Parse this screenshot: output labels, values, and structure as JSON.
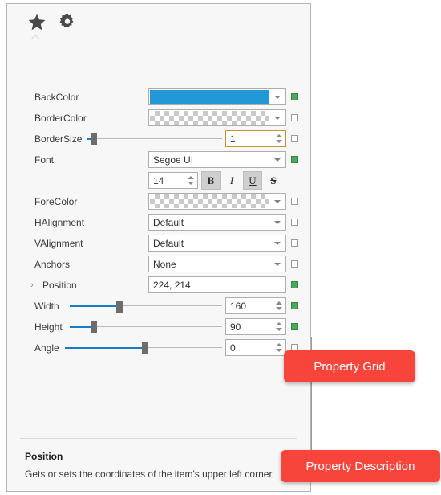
{
  "panel": {
    "tabs": [
      {
        "id": "favorites",
        "icon": "star-icon",
        "active": true
      },
      {
        "id": "settings",
        "icon": "gear-icon",
        "active": false
      }
    ]
  },
  "grid": {
    "rows": [
      {
        "label": "BackColor",
        "editor": "color",
        "value": "",
        "swatch": "#2299d6",
        "indicator": true
      },
      {
        "label": "BorderColor",
        "editor": "color",
        "value": "",
        "swatch": "transparent",
        "indicator": false
      },
      {
        "label": "BorderSize",
        "editor": "slider",
        "value": "1",
        "indicator": false,
        "slider_pct": 4,
        "focused": true
      },
      {
        "label": "Font",
        "editor": "combo",
        "value": "Segoe UI",
        "indicator": true
      },
      {
        "label": "",
        "editor": "fontstyle",
        "value": "14",
        "indicator": null
      },
      {
        "label": "ForeColor",
        "editor": "color",
        "value": "",
        "swatch": "transparent",
        "indicator": false
      },
      {
        "label": "HAlignment",
        "editor": "combo",
        "value": "Default",
        "indicator": false
      },
      {
        "label": "VAlignment",
        "editor": "combo",
        "value": "Default",
        "indicator": false
      },
      {
        "label": "Anchors",
        "editor": "combo",
        "value": "None",
        "indicator": false
      },
      {
        "label": "Position",
        "editor": "text",
        "value": "224, 214",
        "indicator": true,
        "expandable": true
      },
      {
        "label": "Width",
        "editor": "slider",
        "value": "160",
        "indicator": true,
        "slider_pct": 33
      },
      {
        "label": "Height",
        "editor": "slider",
        "value": "90",
        "indicator": true,
        "slider_pct": 17
      },
      {
        "label": "Angle",
        "editor": "slider",
        "value": "0",
        "indicator": false,
        "slider_pct": 52
      }
    ],
    "expander_glyph": "›"
  },
  "font_style": {
    "size": "14",
    "buttons": [
      {
        "name": "bold",
        "label": "B",
        "pressed": true
      },
      {
        "name": "italic",
        "label": "I",
        "pressed": false
      },
      {
        "name": "underline",
        "label": "U",
        "pressed": true
      },
      {
        "name": "strikeout",
        "label": "S",
        "pressed": false
      }
    ]
  },
  "description": {
    "title": "Position",
    "text": "Gets or sets the coordinates of the item's upper left corner."
  },
  "callouts": [
    {
      "id": "property-grid",
      "label": "Property Grid"
    },
    {
      "id": "property-description",
      "label": "Property Description"
    }
  ],
  "colors": {
    "callout": "#f7453c",
    "indicator_on": "#4da85c",
    "slider_fill": "#1a7ac4",
    "backcolor_swatch": "#2299d6"
  }
}
